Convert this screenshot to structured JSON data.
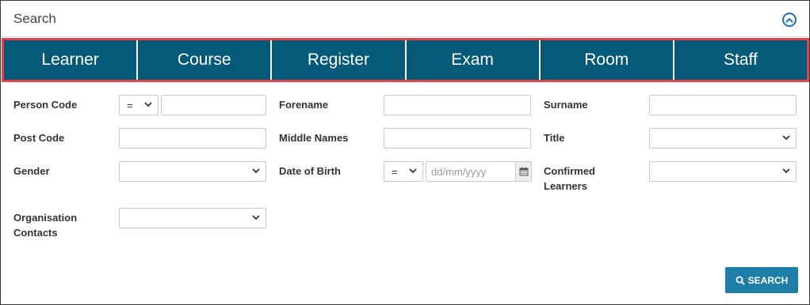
{
  "panel": {
    "title": "Search"
  },
  "tabs": [
    {
      "label": "Learner"
    },
    {
      "label": "Course"
    },
    {
      "label": "Register"
    },
    {
      "label": "Exam"
    },
    {
      "label": "Room"
    },
    {
      "label": "Staff"
    }
  ],
  "fields": {
    "person_code": {
      "label": "Person Code",
      "operator": "=",
      "value": ""
    },
    "forename": {
      "label": "Forename",
      "value": ""
    },
    "surname": {
      "label": "Surname",
      "value": ""
    },
    "post_code": {
      "label": "Post Code",
      "value": ""
    },
    "middle_names": {
      "label": "Middle Names",
      "value": ""
    },
    "title": {
      "label": "Title",
      "value": ""
    },
    "gender": {
      "label": "Gender",
      "value": ""
    },
    "date_of_birth": {
      "label": "Date of Birth",
      "operator": "=",
      "placeholder": "dd/mm/yyyy"
    },
    "confirmed_learners": {
      "label_line1": "Confirmed",
      "label_line2": "Learners",
      "value": ""
    },
    "organisation_contacts": {
      "label_line1": "Organisation",
      "label_line2": "Contacts",
      "value": ""
    }
  },
  "actions": {
    "search_label": "SEARCH"
  },
  "colors": {
    "tab_bg": "#045a78",
    "tab_outline": "#e0454b",
    "button_bg": "#1d7ea8",
    "accent": "#1e6fb0"
  },
  "icons": {
    "collapse": "chevron-up-circle-icon",
    "calendar": "calendar-icon",
    "search": "search-icon"
  }
}
